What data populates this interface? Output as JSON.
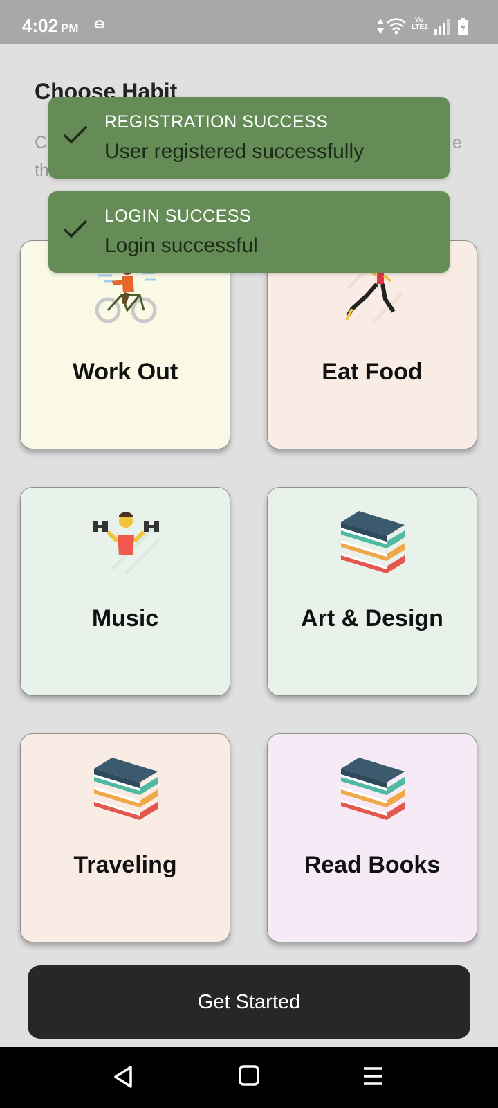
{
  "status_bar": {
    "time": "4:02",
    "ampm": "PM",
    "volte_top": "Vo",
    "volte_bottom": "LTE2",
    "icons": [
      "hat-icon",
      "data-arrows-icon",
      "wifi-icon",
      "volte-icon",
      "signal-icon",
      "battery-charging-icon"
    ]
  },
  "header": {
    "title": "Choose Habit",
    "subtitle_visible_fragments": [
      "C",
      "th",
      "e"
    ]
  },
  "toasts": [
    {
      "title": "REGISTRATION SUCCESS",
      "message": "User registered successfully",
      "icon": "check-icon"
    },
    {
      "title": "LOGIN SUCCESS",
      "message": "Login successful",
      "icon": "check-icon"
    }
  ],
  "habits": [
    {
      "label": "Work Out",
      "icon": "cyclist-icon",
      "bg": "#f9f9e6"
    },
    {
      "label": "Eat Food",
      "icon": "runner-icon",
      "bg": "#f9ece4"
    },
    {
      "label": "Music",
      "icon": "dumbbell-man-icon",
      "bg": "#e8f2eb"
    },
    {
      "label": "Art & Design",
      "icon": "books-icon",
      "bg": "#e8f2eb"
    },
    {
      "label": "Traveling",
      "icon": "books-icon",
      "bg": "#f9ece4"
    },
    {
      "label": "Read Books",
      "icon": "books-icon",
      "bg": "#f5eaf5"
    }
  ],
  "button": {
    "label": "Get Started"
  },
  "nav": {
    "icons": [
      "back-icon",
      "home-icon",
      "menu-icon"
    ]
  },
  "colors": {
    "toast_bg": "#658c57",
    "button_bg": "#262727",
    "status_bar_bg": "#a8a8a8"
  }
}
